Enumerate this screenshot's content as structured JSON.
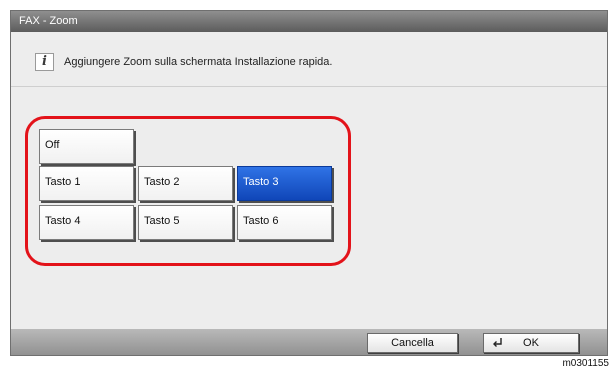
{
  "window": {
    "title": "FAX - Zoom"
  },
  "info": {
    "icon": "info-icon",
    "glyph": "i",
    "message": "Aggiungere Zoom sulla schermata Installazione rapida."
  },
  "options": {
    "off": "Off",
    "keys": [
      "Tasto 1",
      "Tasto 2",
      "Tasto 3",
      "Tasto 4",
      "Tasto 5",
      "Tasto 6"
    ],
    "selected": "Tasto 3"
  },
  "footer": {
    "cancel_label": "Cancella",
    "ok_label": "OK",
    "ok_icon": "enter-key-icon"
  },
  "figure_code": "m0301155",
  "colors": {
    "selected": "#1a56cf",
    "highlight": "#e3131a",
    "titlebar": "#6e6e6e"
  }
}
